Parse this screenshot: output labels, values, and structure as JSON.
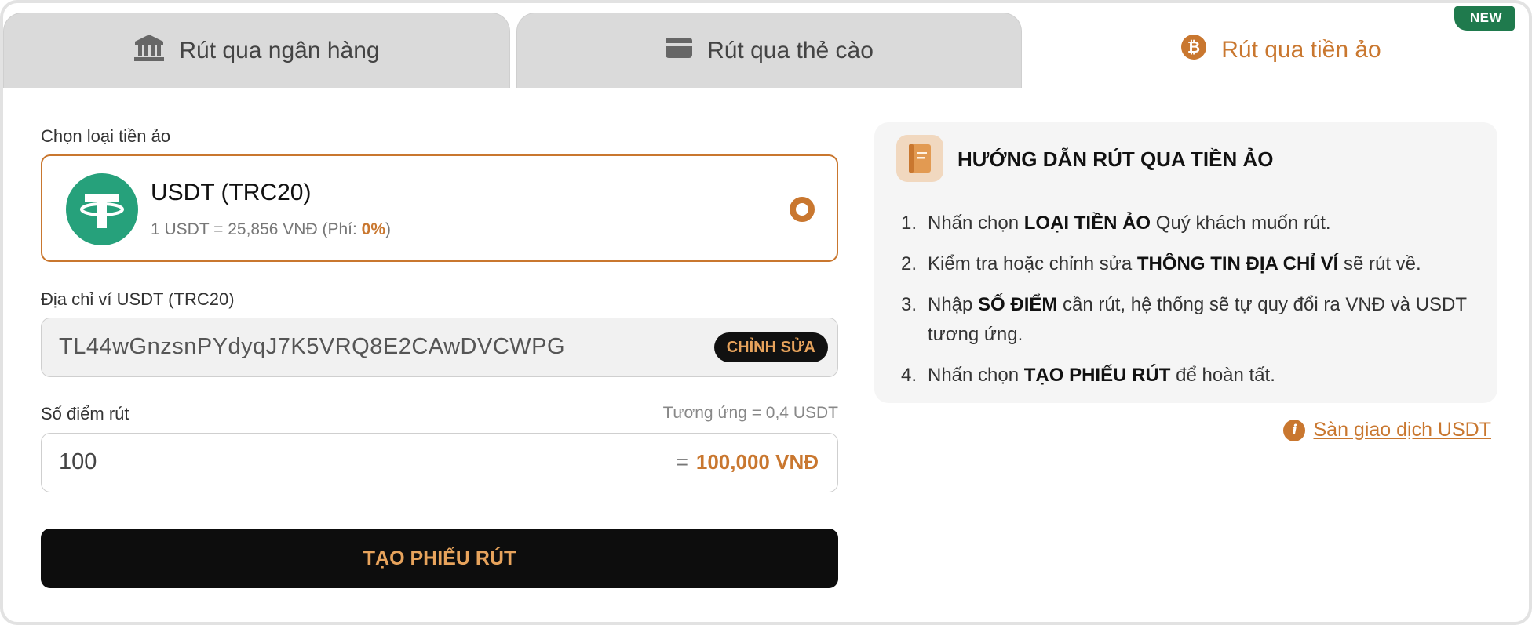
{
  "tabs": [
    {
      "label": "Rút qua ngân hàng",
      "icon": "bank-icon",
      "active": false
    },
    {
      "label": "Rút qua thẻ cào",
      "icon": "card-icon",
      "active": false
    },
    {
      "label": "Rút qua tiền ảo",
      "icon": "bitcoin-icon",
      "active": true
    }
  ],
  "new_badge": "NEW",
  "form": {
    "coin_label": "Chọn loại tiền ảo",
    "coin": {
      "name": "USDT (TRC20)",
      "rate_prefix": "1 USDT = 25,856 VNĐ (Phí: ",
      "fee": "0%",
      "rate_suffix": ")",
      "icon": "tether-icon"
    },
    "wallet_label": "Địa chỉ ví USDT (TRC20)",
    "wallet_value": "TL44wGnzsnPYdyqJ7K5VRQ8E2CAwDVCWPG",
    "edit_label": "CHỈNH SỬA",
    "points_label": "Số điểm rút",
    "equivalent": "Tương ứng = 0,4 USDT",
    "points_value": "100",
    "points_eq_sign": "=",
    "points_vnd": "100,000 VNĐ",
    "submit_label": "TẠO PHIẾU RÚT"
  },
  "guide": {
    "title": "HƯỚNG DẪN RÚT QUA TIỀN ẢO",
    "steps": [
      {
        "num": "1.",
        "a": "Nhấn chọn ",
        "b": "LOẠI TIỀN ẢO",
        "c": " Quý khách muốn rút."
      },
      {
        "num": "2.",
        "a": "Kiểm tra hoặc chỉnh sửa ",
        "b": "THÔNG TIN ĐỊA CHỈ VÍ",
        "c": " sẽ rút về."
      },
      {
        "num": "3.",
        "a": "Nhập ",
        "b": "SỐ ĐIỂM",
        "c": " cần rút, hệ thống sẽ tự quy đổi ra VNĐ và USDT tương ứng."
      },
      {
        "num": "4.",
        "a": "Nhấn chọn ",
        "b": "TẠO PHIẾU RÚT",
        "c": " để hoàn tất."
      }
    ],
    "link_label": "Sàn giao dịch USDT",
    "info_glyph": "i"
  },
  "colors": {
    "accent": "#c9772f",
    "tether": "#26a17b",
    "badge": "#1f7a4d"
  }
}
